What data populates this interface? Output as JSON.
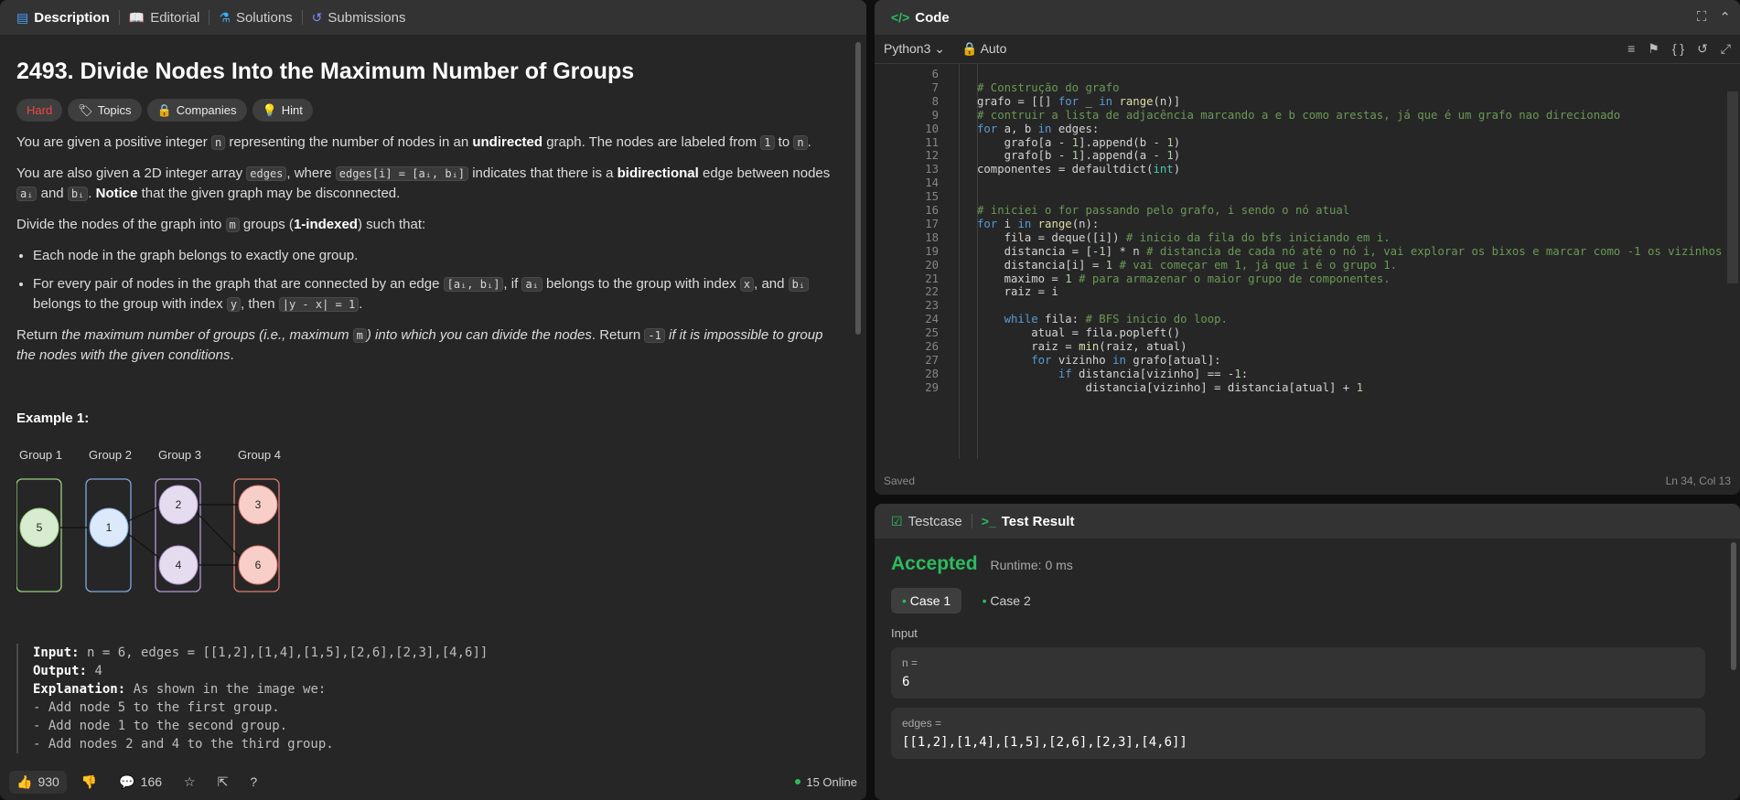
{
  "left": {
    "tabs": [
      {
        "label": "Description",
        "icon": "document-icon"
      },
      {
        "label": "Editorial",
        "icon": "book-icon"
      },
      {
        "label": "Solutions",
        "icon": "flask-icon"
      },
      {
        "label": "Submissions",
        "icon": "history-icon"
      }
    ],
    "title": "2493. Divide Nodes Into the Maximum Number of Groups",
    "tags": [
      "Hard",
      "Topics",
      "Companies",
      "Hint"
    ],
    "p1": {
      "t1": "You are given a positive integer ",
      "c1": "n",
      "t2": " representing the number of nodes in an ",
      "b1": "undirected",
      "t3": " graph. The nodes are labeled from ",
      "c2": "1",
      "t4": " to ",
      "c3": "n",
      "t5": "."
    },
    "p2": {
      "t1": "You are also given a 2D integer array ",
      "c1": "edges",
      "t2": ", where ",
      "c2": "edges[i] = [aᵢ, bᵢ]",
      "t3": " indicates that there is a ",
      "b1": "bidirectional",
      "t4": " edge between nodes ",
      "c3": "aᵢ",
      "t5": " and ",
      "c4": "bᵢ",
      "t6": ". ",
      "b2": "Notice",
      "t7": " that the given graph may be disconnected."
    },
    "p3": {
      "t1": "Divide the nodes of the graph into ",
      "c1": "m",
      "t2": " groups (",
      "b1": "1-indexed",
      "t3": ") such that:"
    },
    "li1": "Each node in the graph belongs to exactly one group.",
    "li2": {
      "t1": "For every pair of nodes in the graph that are connected by an edge ",
      "c1": "[aᵢ, bᵢ]",
      "t2": ", if ",
      "c2": "aᵢ",
      "t3": " belongs to the group with index ",
      "c3": "x",
      "t4": ", and ",
      "c4": "bᵢ",
      "t5": " belongs to the group with index ",
      "c5": "y",
      "t6": ", then ",
      "c6": "|y - x| = 1",
      "t7": "."
    },
    "p4": {
      "t1": "Return ",
      "i1": "the maximum number of groups (i.e., maximum ",
      "c1": "m",
      "i2": ") into which you can divide the nodes",
      "t2": ". Return ",
      "c2": "-1",
      "i3": " if it is impossible to group the nodes with the given conditions",
      "t3": "."
    },
    "example_title": "Example 1:",
    "diagram": {
      "groups": [
        "Group 1",
        "Group 2",
        "Group 3",
        "Group 4"
      ],
      "nodes": [
        "5",
        "1",
        "2",
        "4",
        "3",
        "6"
      ]
    },
    "example": {
      "input_label": "Input:",
      "input": " n = 6, edges = [[1,2],[1,4],[1,5],[2,6],[2,3],[4,6]]",
      "output_label": "Output:",
      "output": " 4",
      "explanation_label": "Explanation:",
      "explanation": " As shown in the image we:",
      "lines": [
        "- Add node 5 to the first group.",
        "- Add node 1 to the second group.",
        "- Add nodes 2 and 4 to the third group."
      ]
    },
    "bottom": {
      "likes": "930",
      "comments": "166",
      "online": "15 Online"
    }
  },
  "code": {
    "title": "Code",
    "language": "Python3",
    "mode": "Auto",
    "saved": "Saved",
    "cursor": "Ln 34, Col 13",
    "lines": [
      {
        "n": "6",
        "html": ""
      },
      {
        "n": "7",
        "html": "<span class='cm'># Construção do grafo</span>"
      },
      {
        "n": "8",
        "html": "grafo = [[] <span class='kw'>for</span> _ <span class='kw'>in</span> <span class='fn'>range</span>(n)]"
      },
      {
        "n": "9",
        "html": "<span class='cm'># contruir a lista de adjacência marcando a e b como arestas, já que é um grafo nao direcionado</span>"
      },
      {
        "n": "10",
        "html": "<span class='kw'>for</span> a, b <span class='kw'>in</span> edges:"
      },
      {
        "n": "11",
        "html": "    grafo[a - <span class='num'>1</span>].append(b - <span class='num'>1</span>)"
      },
      {
        "n": "12",
        "html": "    grafo[b - <span class='num'>1</span>].append(a - <span class='num'>1</span>)"
      },
      {
        "n": "13",
        "html": "componentes = defaultdict(<span class='ty'>int</span>)"
      },
      {
        "n": "14",
        "html": ""
      },
      {
        "n": "15",
        "html": ""
      },
      {
        "n": "16",
        "html": "<span class='cm'># iniciei o for passando pelo grafo, i sendo o nó atual</span>"
      },
      {
        "n": "17",
        "html": "<span class='kw'>for</span> i <span class='kw'>in</span> <span class='fn'>range</span>(n):"
      },
      {
        "n": "18",
        "html": "    fila = deque([i]) <span class='cm'># inicio da fila do bfs iniciando em i.</span>"
      },
      {
        "n": "19",
        "html": "    distancia = [-<span class='num'>1</span>] * n <span class='cm'># distancia de cada nó até o nó i, vai explorar os bixos e marcar como -1 os vizinhos</span>"
      },
      {
        "n": "20",
        "html": "    distancia[i] = <span class='num'>1</span> <span class='cm'># vai começar em 1, já que i é o grupo 1.</span>"
      },
      {
        "n": "21",
        "html": "    maximo = <span class='num'>1</span> <span class='cm'># para armazenar o maior grupo de componentes.</span>"
      },
      {
        "n": "22",
        "html": "    raiz = i"
      },
      {
        "n": "23",
        "html": ""
      },
      {
        "n": "24",
        "html": "    <span class='kw'>while</span> fila: <span class='cm'># BFS inicio do loop.</span>"
      },
      {
        "n": "25",
        "html": "        atual = fila.popleft()"
      },
      {
        "n": "26",
        "html": "        raiz = <span class='fn'>min</span>(raiz, atual)"
      },
      {
        "n": "27",
        "html": "        <span class='kw'>for</span> vizinho <span class='kw'>in</span> grafo[atual]:"
      },
      {
        "n": "28",
        "html": "            <span class='kw'>if</span> distancia[vizinho] == -<span class='num'>1</span>:"
      },
      {
        "n": "29",
        "html": "                distancia[vizinho] = distancia[atual] + <span class='num'>1</span>"
      }
    ]
  },
  "result": {
    "tabs": [
      "Testcase",
      "Test Result"
    ],
    "status": "Accepted",
    "runtime": "Runtime: 0 ms",
    "cases": [
      "Case 1",
      "Case 2"
    ],
    "input_label": "Input",
    "fields": [
      {
        "label": "n =",
        "value": "6"
      },
      {
        "label": "edges =",
        "value": "[[1,2],[1,4],[1,5],[2,6],[2,3],[4,6]]"
      }
    ]
  },
  "colors": {
    "accepted": "#2cbb5d",
    "hard": "#ef4743",
    "accent": "#4a9eff"
  }
}
